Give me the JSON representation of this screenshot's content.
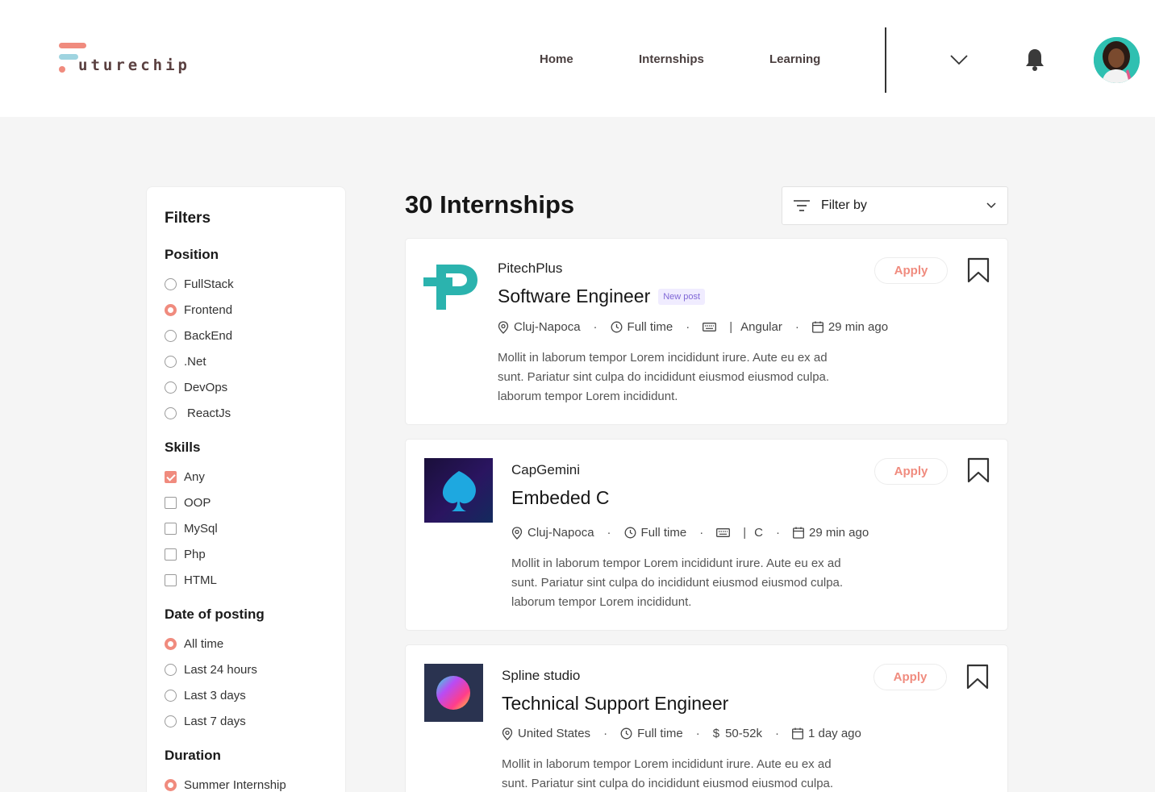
{
  "brand": {
    "logo_text": "uturechip"
  },
  "nav": {
    "home": "Home",
    "internships": "Internships",
    "learning": "Learning"
  },
  "filters": {
    "title": "Filters",
    "position": {
      "label": "Position",
      "options": [
        "FullStack",
        "Frontend",
        "BackEnd",
        ".Net",
        "DevOps",
        "ReactJs"
      ],
      "selected": "Frontend"
    },
    "skills": {
      "label": "Skills",
      "options": [
        "Any",
        "OOP",
        "MySql",
        "Php",
        "HTML"
      ],
      "checked": [
        "Any"
      ]
    },
    "date": {
      "label": "Date of posting",
      "options": [
        "All time",
        "Last 24 hours",
        "Last 3 days",
        "Last 7 days"
      ],
      "selected": "All time"
    },
    "duration": {
      "label": "Duration",
      "options": [
        "Summer Internship"
      ],
      "selected": "Summer Internship"
    }
  },
  "main": {
    "count_title": "30 Internships",
    "filter_by": "Filter by",
    "apply_label": "Apply",
    "cards": [
      {
        "company": "PitechPlus",
        "role": "Software Engineer",
        "badge": "New post",
        "location": "Cluj-Napoca",
        "type": "Full time",
        "skill": "Angular",
        "posted": "29 min ago",
        "description": "Mollit in laborum tempor Lorem incididunt irure. Aute eu ex ad sunt. Pariatur sint culpa do incididunt eiusmod eiusmod culpa. laborum tempor Lorem incididunt."
      },
      {
        "company": "CapGemini",
        "role": "Embeded C",
        "location": "Cluj-Napoca",
        "type": "Full time",
        "skill": "C",
        "posted": "29 min ago",
        "description": "Mollit in laborum tempor Lorem incididunt irure. Aute eu ex ad sunt. Pariatur sint culpa do incididunt eiusmod eiusmod culpa. laborum tempor Lorem incididunt."
      },
      {
        "company": "Spline studio",
        "role": "Technical Support Engineer",
        "location": "United States",
        "type": "Full time",
        "salary": "50-52k",
        "posted": "1 day ago",
        "description": "Mollit in laborum tempor Lorem incididunt irure. Aute eu ex ad sunt. Pariatur sint culpa do incididunt eiusmod eiusmod culpa. laborum tempor Lorem incididunt."
      }
    ]
  },
  "colors": {
    "accent": "#f08b7e",
    "badge": "#8068d6",
    "teal": "#2fc0b1"
  },
  "icons": [
    "chevron-down-icon",
    "bell-icon",
    "filter-icon",
    "location-icon",
    "clock-icon",
    "keyboard-icon",
    "calendar-icon",
    "dollar-icon",
    "bookmark-icon"
  ]
}
